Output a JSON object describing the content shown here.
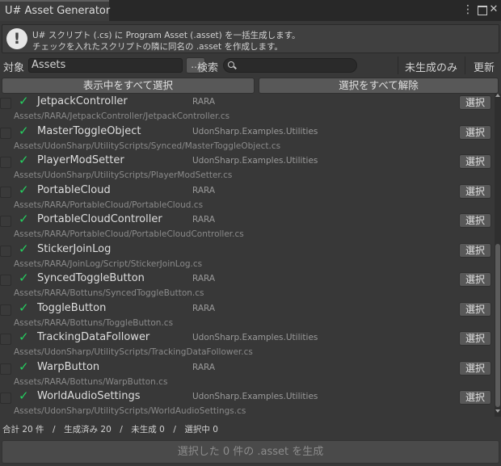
{
  "window": {
    "title": "U# Asset Generator"
  },
  "help": {
    "line1": "U# スクリプト (.cs) に Program Asset (.asset) を一括生成します。",
    "line2": "チェックを入れたスクリプトの隣に同名の .asset を作成します。"
  },
  "toolbar": {
    "target_label": "対象",
    "target_value": "Assets",
    "browse_label": "...",
    "search_label": "検索",
    "search_value": "",
    "filter_label": "未生成のみ",
    "refresh_label": "更新"
  },
  "actions": {
    "select_all_visible": "表示中をすべて選択",
    "deselect_all": "選択をすべて解除"
  },
  "items": [
    {
      "name": "JetpackController",
      "namespace": "RARA",
      "path": "Assets/RARA/JetpackController/JetpackController.cs",
      "checked": false,
      "generated": true,
      "select_label": "選択"
    },
    {
      "name": "MasterToggleObject",
      "namespace": "UdonSharp.Examples.Utilities",
      "path": "Assets/UdonSharp/UtilityScripts/Synced/MasterToggleObject.cs",
      "checked": false,
      "generated": true,
      "select_label": "選択"
    },
    {
      "name": "PlayerModSetter",
      "namespace": "UdonSharp.Examples.Utilities",
      "path": "Assets/UdonSharp/UtilityScripts/PlayerModSetter.cs",
      "checked": false,
      "generated": true,
      "select_label": "選択"
    },
    {
      "name": "PortableCloud",
      "namespace": "RARA",
      "path": "Assets/RARA/PortableCloud/PortableCloud.cs",
      "checked": false,
      "generated": true,
      "select_label": "選択"
    },
    {
      "name": "PortableCloudController",
      "namespace": "RARA",
      "path": "Assets/RARA/PortableCloud/PortableCloudController.cs",
      "checked": false,
      "generated": true,
      "select_label": "選択"
    },
    {
      "name": "StickerJoinLog",
      "namespace": "",
      "path": "Assets/RARA/JoinLog/Script/StickerJoinLog.cs",
      "checked": false,
      "generated": true,
      "select_label": "選択"
    },
    {
      "name": "SyncedToggleButton",
      "namespace": "RARA",
      "path": "Assets/RARA/Bottuns/SyncedToggleButton.cs",
      "checked": false,
      "generated": true,
      "select_label": "選択"
    },
    {
      "name": "ToggleButton",
      "namespace": "RARA",
      "path": "Assets/RARA/Bottuns/ToggleButton.cs",
      "checked": false,
      "generated": true,
      "select_label": "選択"
    },
    {
      "name": "TrackingDataFollower",
      "namespace": "UdonSharp.Examples.Utilities",
      "path": "Assets/UdonSharp/UtilityScripts/TrackingDataFollower.cs",
      "checked": false,
      "generated": true,
      "select_label": "選択"
    },
    {
      "name": "WarpButton",
      "namespace": "RARA",
      "path": "Assets/RARA/Bottuns/WarpButton.cs",
      "checked": false,
      "generated": true,
      "select_label": "選択"
    },
    {
      "name": "WorldAudioSettings",
      "namespace": "UdonSharp.Examples.Utilities",
      "path": "Assets/UdonSharp/UtilityScripts/WorldAudioSettings.cs",
      "checked": false,
      "generated": true,
      "select_label": "選択"
    }
  ],
  "footer": {
    "stats": "合計 20 件　/　生成済み 20　/　未生成 0　/　選択中 0",
    "generate_label": "選択した 0 件の .asset を生成"
  },
  "colors": {
    "background": "#383838",
    "check": "#25d160",
    "button": "#585858"
  }
}
